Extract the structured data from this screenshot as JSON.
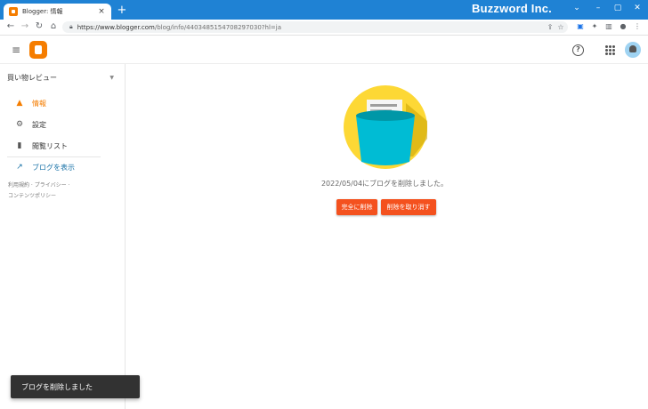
{
  "browser": {
    "tab_title": "Blogger: 情報",
    "tab_close": "×",
    "new_tab": "+",
    "brand": "Buzzword Inc.",
    "window_controls": [
      "⌄",
      "–",
      "▢",
      "✕"
    ],
    "url_host": "https://www.blogger.com",
    "url_path": "/blog/info/4403485154708297030?hl=ja",
    "nav_icons": [
      "back-icon",
      "forward-icon",
      "reload-icon",
      "home-icon"
    ]
  },
  "app": {
    "header": {
      "menu_icon": "menu-icon",
      "logo": "blogger-logo",
      "help_glyph": "?"
    },
    "sidebar": {
      "blog_name": "買い物レビュー",
      "items": [
        {
          "label": "情報",
          "icon": "warning-icon",
          "glyph": "▲",
          "active": true
        },
        {
          "label": "設定",
          "icon": "gear-icon",
          "glyph": "⚙",
          "active": false
        },
        {
          "label": "閲覧リスト",
          "icon": "bookmark-icon",
          "glyph": "▮",
          "active": false
        }
      ],
      "view_blog": {
        "label": "ブログを表示",
        "icon": "external-link-icon",
        "glyph": "↗"
      },
      "footer_line1": "利用規約 · プライバシー ·",
      "footer_line2": "コンテンツポリシー"
    },
    "main": {
      "deleted_message": "2022/05/04にブログを削除しました。",
      "delete_forever_label": "完全に削除",
      "undo_delete_label": "削除を取り消す"
    },
    "snackbar": {
      "text": "ブログを削除しました"
    },
    "colors": {
      "accent": "#f57d00",
      "button": "#f4511e",
      "titlebar": "#1f82d4",
      "illus_circle": "#fdd835",
      "illus_bin": "#00bcd4"
    }
  }
}
